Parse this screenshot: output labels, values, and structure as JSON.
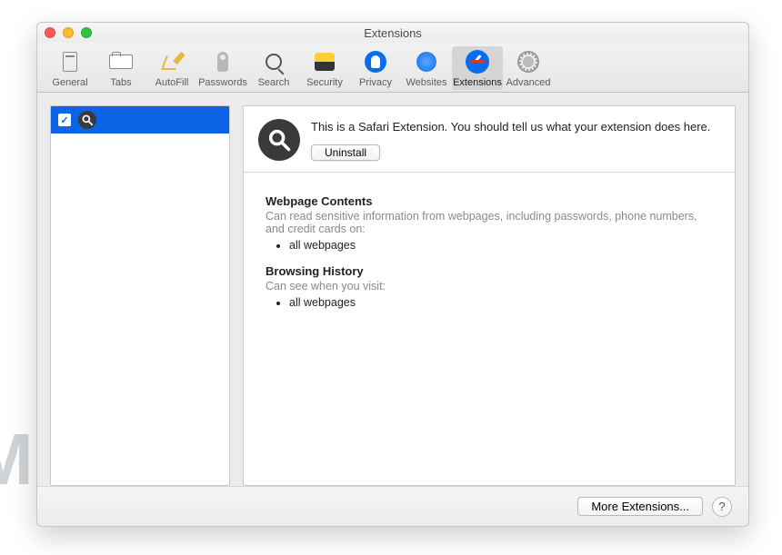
{
  "window": {
    "title": "Extensions"
  },
  "toolbar": {
    "items": [
      {
        "label": "General",
        "icon": "general-icon"
      },
      {
        "label": "Tabs",
        "icon": "tabs-icon"
      },
      {
        "label": "AutoFill",
        "icon": "autofill-icon"
      },
      {
        "label": "Passwords",
        "icon": "key-icon"
      },
      {
        "label": "Search",
        "icon": "search-icon"
      },
      {
        "label": "Security",
        "icon": "security-icon"
      },
      {
        "label": "Privacy",
        "icon": "privacy-icon"
      },
      {
        "label": "Websites",
        "icon": "websites-icon"
      },
      {
        "label": "Extensions",
        "icon": "extensions-icon",
        "active": true
      },
      {
        "label": "Advanced",
        "icon": "advanced-icon"
      }
    ]
  },
  "sidebar": {
    "items": [
      {
        "checked": true,
        "icon": "magnifier-icon"
      }
    ]
  },
  "detail": {
    "description": "This is a Safari Extension. You should tell us what your extension does here.",
    "uninstall_label": "Uninstall",
    "sections": [
      {
        "title": "Webpage Contents",
        "subtitle": "Can read sensitive information from webpages, including passwords, phone numbers, and credit cards on:",
        "items": [
          "all webpages"
        ]
      },
      {
        "title": "Browsing History",
        "subtitle": "Can see when you visit:",
        "items": [
          "all webpages"
        ]
      }
    ]
  },
  "footer": {
    "more_label": "More Extensions...",
    "help_label": "?"
  },
  "watermark": "MALWARETIPS"
}
